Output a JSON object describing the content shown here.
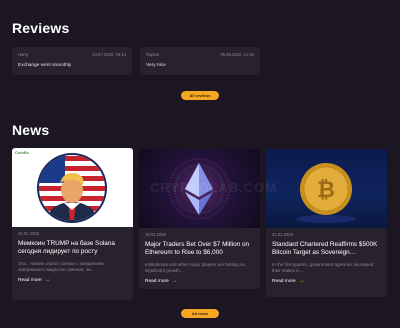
{
  "reviews": {
    "title": "Reviews",
    "items": [
      {
        "author": "Harry",
        "date": "13.07.2020, 08:14",
        "text": "Exchange went smoothly"
      },
      {
        "author": "Rapsui",
        "date": "05.08.2022, 21:43",
        "text": "Very nice"
      }
    ],
    "more_button": "All reviews"
  },
  "news": {
    "title": "News",
    "items": [
      {
        "source": "CoinEx",
        "date": "15.01.2025",
        "headline": "Мемкоин TRUMP на базе Solana сегодня лидирует по росту",
        "excerpt": "Эта…ческих отрасл связан с ожиданием завтрашнего закрытого умения, на…",
        "read_more": "Read more",
        "image_icon": "trump-portrait-icon"
      },
      {
        "date": "15.01.2025",
        "headline": "Major Traders Bet Over $7 Million on Ethereum to Rise to $6,000",
        "excerpt": "Institutional and other major players are betting on significant growth…",
        "read_more": "Read more",
        "image_icon": "ethereum-icon"
      },
      {
        "date": "21.01.2025",
        "headline": "Standard Chartered Reaffirms $500K Bitcoin Target as Sovereign…",
        "excerpt": "In the first quarter, government agencies increased their stakes in…",
        "read_more": "Read more",
        "image_icon": "bitcoin-coin-icon"
      }
    ],
    "more_button": "All news"
  },
  "watermark_text": "CRYPTOLAB.COM",
  "colors": {
    "background": "#1b1621",
    "card": "#28222f",
    "accent": "#f5a623"
  }
}
